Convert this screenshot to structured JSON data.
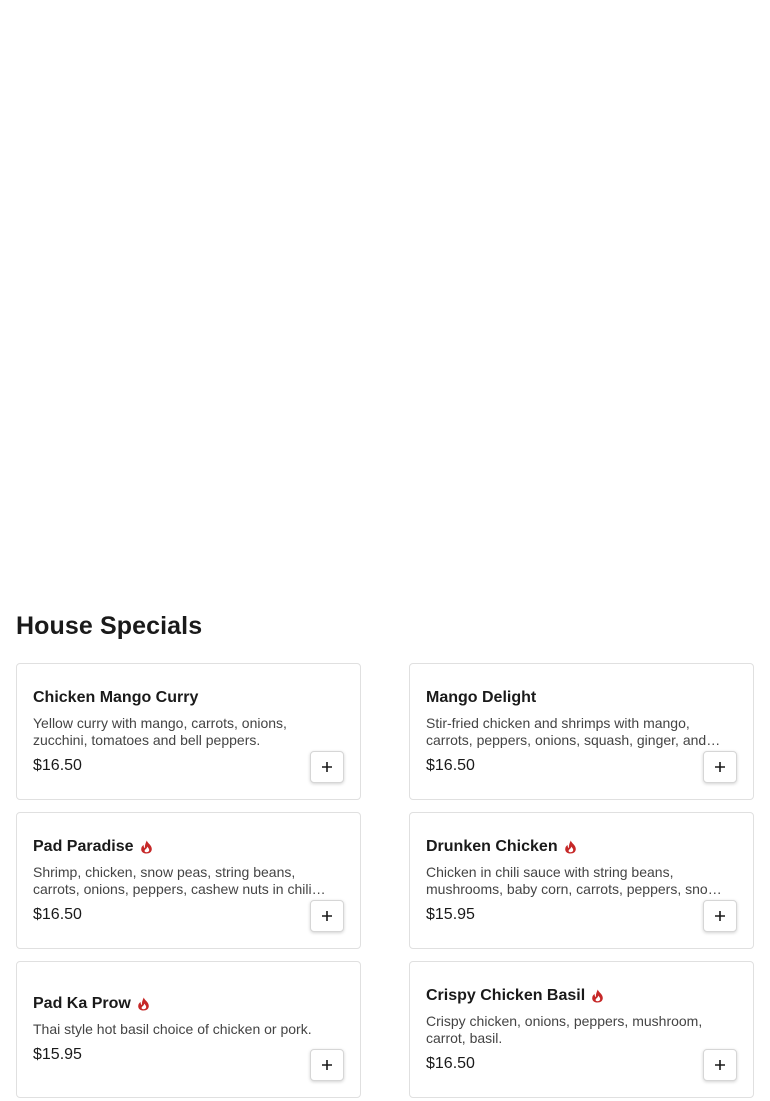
{
  "section": {
    "title": "House Specials"
  },
  "colors": {
    "spicy_icon": "#c62828",
    "card_border": "#e0e0e0"
  },
  "items": [
    {
      "name": "Chicken Mango Curry",
      "description": "Yellow curry with mango, carrots, onions, zucchini, tomatoes and bell peppers.",
      "price": "$16.50",
      "spicy": false
    },
    {
      "name": "Mango Delight",
      "description": "Stir-fried chicken and shrimps with mango, carrots, peppers, onions, squash, ginger, and basil.",
      "price": "$16.50",
      "spicy": false
    },
    {
      "name": "Pad Paradise",
      "description": "Shrimp, chicken, snow peas, string beans, carrots, onions, peppers, cashew nuts in chili sauce.",
      "price": "$16.50",
      "spicy": true
    },
    {
      "name": "Drunken Chicken",
      "description": "Chicken in chili sauce with string beans, mushrooms, baby corn, carrots, peppers, snow peas and basil.",
      "price": "$15.95",
      "spicy": true
    },
    {
      "name": "Pad Ka Prow",
      "description": "Thai style hot basil choice of chicken or pork.",
      "price": "$15.95",
      "spicy": true
    },
    {
      "name": "Crispy Chicken Basil",
      "description": "Crispy chicken, onions, peppers, mushroom, carrot, basil.",
      "price": "$16.50",
      "spicy": true
    }
  ]
}
